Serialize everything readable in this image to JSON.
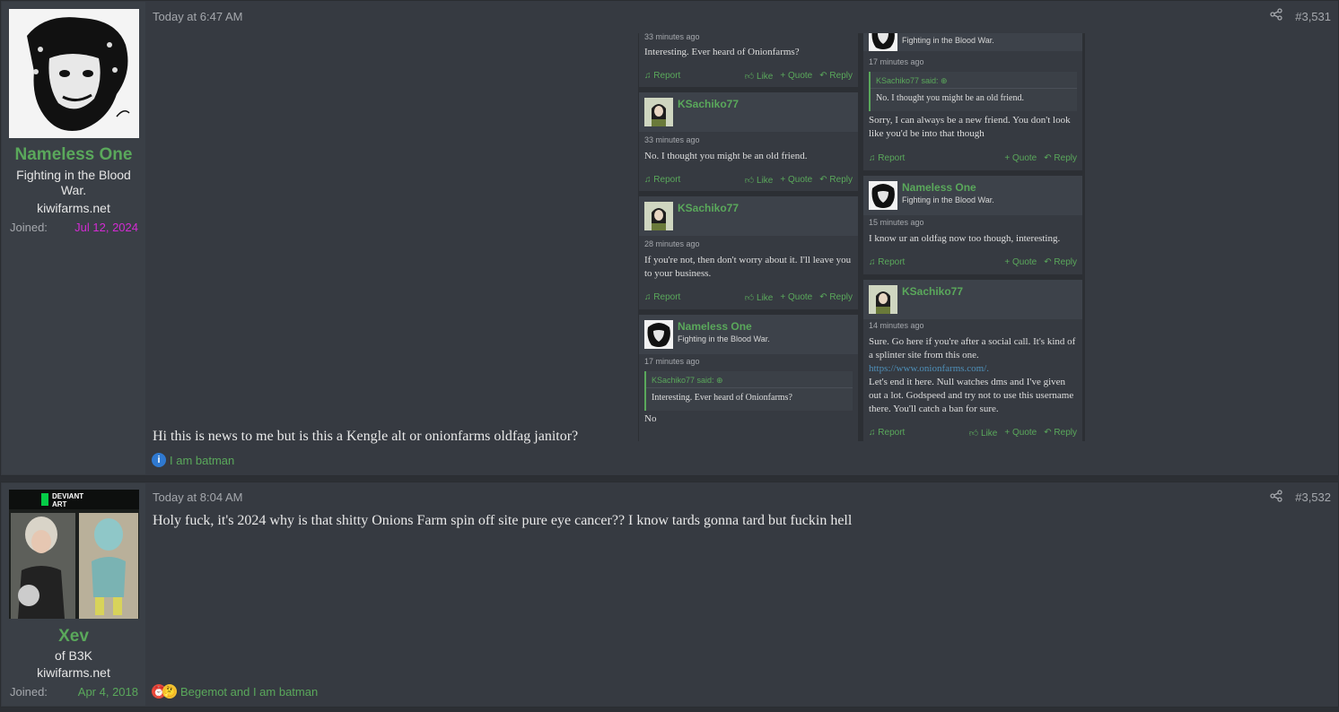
{
  "post1": {
    "user": {
      "name": "Nameless One",
      "title": "Fighting in the Blood War.",
      "site": "kiwifarms.net",
      "joined_label": "Joined:",
      "joined_date": "Jul 12, 2024",
      "joined_color": "#d32bd3"
    },
    "time": "Today at 6:47 AM",
    "number": "#3,531",
    "text": "Hi this is news to me but is this a Kengle alt or onionfarms oldfag janitor?",
    "reactions": "I am batman"
  },
  "post2": {
    "user": {
      "name": "Xev",
      "title": "of B3K",
      "site": "kiwifarms.net",
      "joined_label": "Joined:",
      "joined_date": "Apr 4, 2018",
      "joined_color": "#5aa85b",
      "avatar_text": "DEVIANT ART"
    },
    "time": "Today at 8:04 AM",
    "number": "#3,532",
    "text": "Holy fuck, it's 2024 why is that shitty Onions Farm spin off site pure eye cancer?? I know tards gonna tard but fuckin hell",
    "reactions": "Begemot and I am batman"
  },
  "shot": {
    "left": [
      {
        "time": "33 minutes ago",
        "body": "Interesting. Ever heard of Onionfarms?",
        "report": "Report",
        "like": "Like",
        "quote": "Quote",
        "reply": "Reply"
      },
      {
        "name": "KSachiko77",
        "time": "33 minutes ago",
        "body": "No. I thought you might be an old friend.",
        "report": "Report",
        "like": "Like",
        "quote": "Quote",
        "reply": "Reply"
      },
      {
        "name": "KSachiko77",
        "time": "28 minutes ago",
        "body": "If you're not, then don't worry about it. I'll leave you to your business.",
        "report": "Report",
        "like": "Like",
        "quote": "Quote",
        "reply": "Reply"
      },
      {
        "name": "Nameless One",
        "title": "Fighting in the Blood War.",
        "time": "17 minutes ago",
        "quote_head": "KSachiko77 said: ⊕",
        "quote_body": "Interesting. Ever heard of Onionfarms?",
        "body": "No"
      }
    ],
    "right": [
      {
        "title": "Fighting in the Blood War.",
        "time": "17 minutes ago",
        "quote_head": "KSachiko77 said: ⊕",
        "quote_body": "No. I thought you might be an old friend.",
        "body": "Sorry, I can always be a new friend. You don't look like you'd be into that though",
        "report": "Report",
        "quote": "Quote",
        "reply": "Reply"
      },
      {
        "name": "Nameless One",
        "title": "Fighting in the Blood War.",
        "time": "15 minutes ago",
        "body": "I know ur an oldfag now too though, interesting.",
        "report": "Report",
        "quote": "Quote",
        "reply": "Reply"
      },
      {
        "name": "KSachiko77",
        "time": "14 minutes ago",
        "body1": "Sure. Go here if you're after a social call. It's kind of a splinter site from this one.",
        "link": "https://www.onionfarms.com/.",
        "body2": "Let's end it here. Null watches dms and I've given out a lot. Godspeed and try not to use this username there. You'll catch a ban for sure.",
        "report": "Report",
        "like": "Like",
        "quote": "Quote",
        "reply": "Reply"
      }
    ]
  }
}
